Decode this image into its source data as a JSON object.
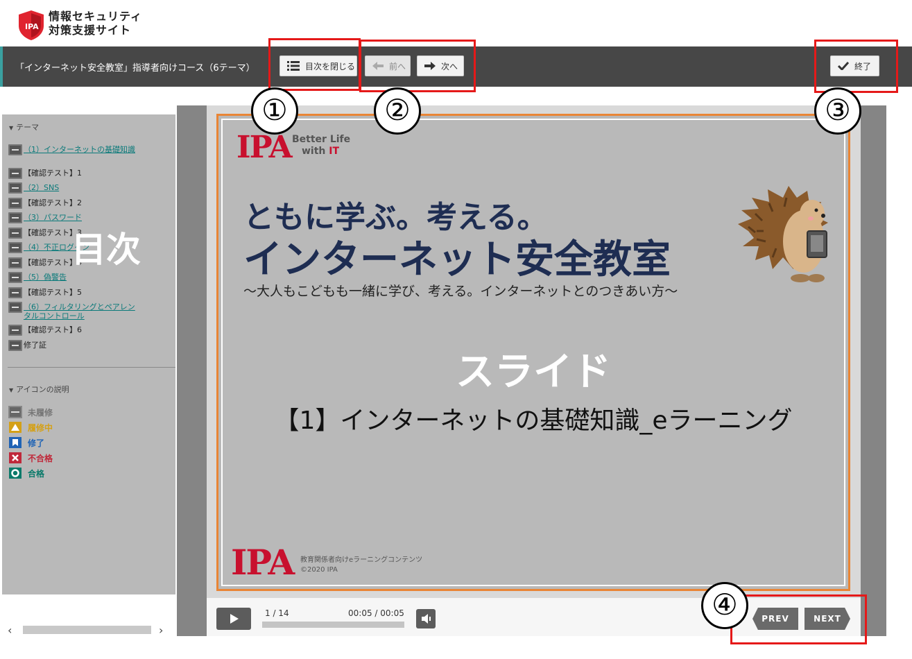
{
  "header": {
    "site_title_line1": "情報セキュリティ",
    "site_title_line2": "対策支援サイト",
    "logo_text": "IPA"
  },
  "toolbar": {
    "course_title": "「インターネット安全教室」指導者向けコース（6テーマ）",
    "toc_button_label": "目次を閉じる",
    "prev_button_label": "前へ",
    "next_button_label": "次へ",
    "finish_button_label": "終了"
  },
  "annotations": {
    "callout_1": "①",
    "callout_2": "②",
    "callout_3": "③",
    "callout_4": "④",
    "accent_color": "#e51919"
  },
  "sidebar": {
    "theme_heading": "テーマ",
    "big_label": "目次",
    "items": [
      {
        "label": "（1）インターネットの基礎知識",
        "status": "not-started",
        "link": true
      },
      {
        "label": "【確認テスト】1",
        "status": "not-started",
        "link": false
      },
      {
        "label": "（2）SNS",
        "status": "not-started",
        "link": true
      },
      {
        "label": "【確認テスト】2",
        "status": "not-started",
        "link": false
      },
      {
        "label": "（3）パスワード",
        "status": "not-started",
        "link": true
      },
      {
        "label": "【確認テスト】3",
        "status": "not-started",
        "link": false
      },
      {
        "label": "（4）不正ログイン",
        "status": "not-started",
        "link": true
      },
      {
        "label": "【確認テスト】4",
        "status": "not-started",
        "link": false
      },
      {
        "label": "（5）偽警告",
        "status": "not-started",
        "link": true
      },
      {
        "label": "【確認テスト】5",
        "status": "not-started",
        "link": false
      },
      {
        "label": "（6）フィルタリングとペアレンタルコントロール",
        "status": "not-started",
        "link": true
      },
      {
        "label": "【確認テスト】6",
        "status": "not-started",
        "link": false
      },
      {
        "label": "修了証",
        "status": "not-started",
        "link": false
      }
    ],
    "legend_heading": "アイコンの説明",
    "legend": [
      {
        "label": "未履修",
        "color": "#777777",
        "icon": "not-started-icon"
      },
      {
        "label": "履修中",
        "color": "#d4a017",
        "icon": "in-progress-icon"
      },
      {
        "label": "修了",
        "color": "#1f63b5",
        "icon": "completed-icon"
      },
      {
        "label": "不合格",
        "color": "#c0283a",
        "icon": "failed-icon"
      },
      {
        "label": "合格",
        "color": "#0b7a6a",
        "icon": "passed-icon"
      }
    ]
  },
  "slide": {
    "logo_text": "IPA",
    "tagline_line1": "Better Life",
    "tagline_line2_prefix": "with ",
    "tagline_line2_highlight": "IT",
    "headline_line1": "ともに学ぶ。考える。",
    "headline_line2": "インターネット安全教室",
    "subtitle": "～大人もこどもも一緒に学び、考える。インターネットとのつきあい方～",
    "overlay_label": "スライド",
    "lesson_title": "【1】インターネットの基礎知識_eラーニング",
    "footer_line1": "教育関係者向けeラーニングコンテンツ",
    "footer_line2": "©2020 IPA"
  },
  "player_controls": {
    "slide_counter": "1 / 14",
    "time": "00:05 / 00:05",
    "prev_label": "PREV",
    "next_label": "NEXT",
    "progress": 1.0
  }
}
